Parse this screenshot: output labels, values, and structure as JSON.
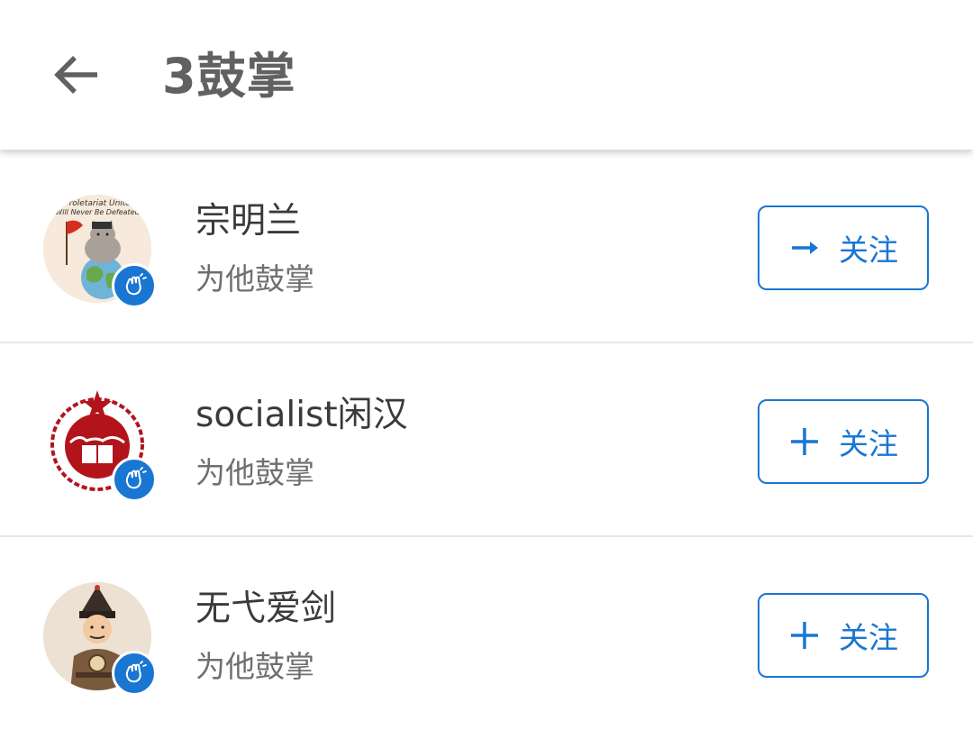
{
  "header": {
    "title": "3鼓掌",
    "back_icon": "arrow-back-icon"
  },
  "colors": {
    "accent": "#1976d2",
    "title_text": "#616161",
    "primary_text": "#3a3a3a",
    "secondary_text": "#6f6f6f",
    "divider": "#e6e6e6"
  },
  "users": [
    {
      "name": "宗明兰",
      "subtitle": "为他鼓掌",
      "avatar_icon": "cat-flag-globe-avatar",
      "avatar_text_line1": "Proletariat Unite",
      "avatar_text_line2": "Will Never Be Defeated",
      "badge_icon": "clap-icon",
      "button_label": "关注",
      "button_icon": "arrow-right-icon"
    },
    {
      "name": "socialist闲汉",
      "subtitle": "为他鼓掌",
      "avatar_icon": "red-emblem-avatar",
      "badge_icon": "clap-icon",
      "button_label": "关注",
      "button_icon": "plus-icon"
    },
    {
      "name": "无弋爱剑",
      "subtitle": "为他鼓掌",
      "avatar_icon": "warrior-cartoon-avatar",
      "badge_icon": "clap-icon",
      "button_label": "关注",
      "button_icon": "plus-icon"
    }
  ]
}
